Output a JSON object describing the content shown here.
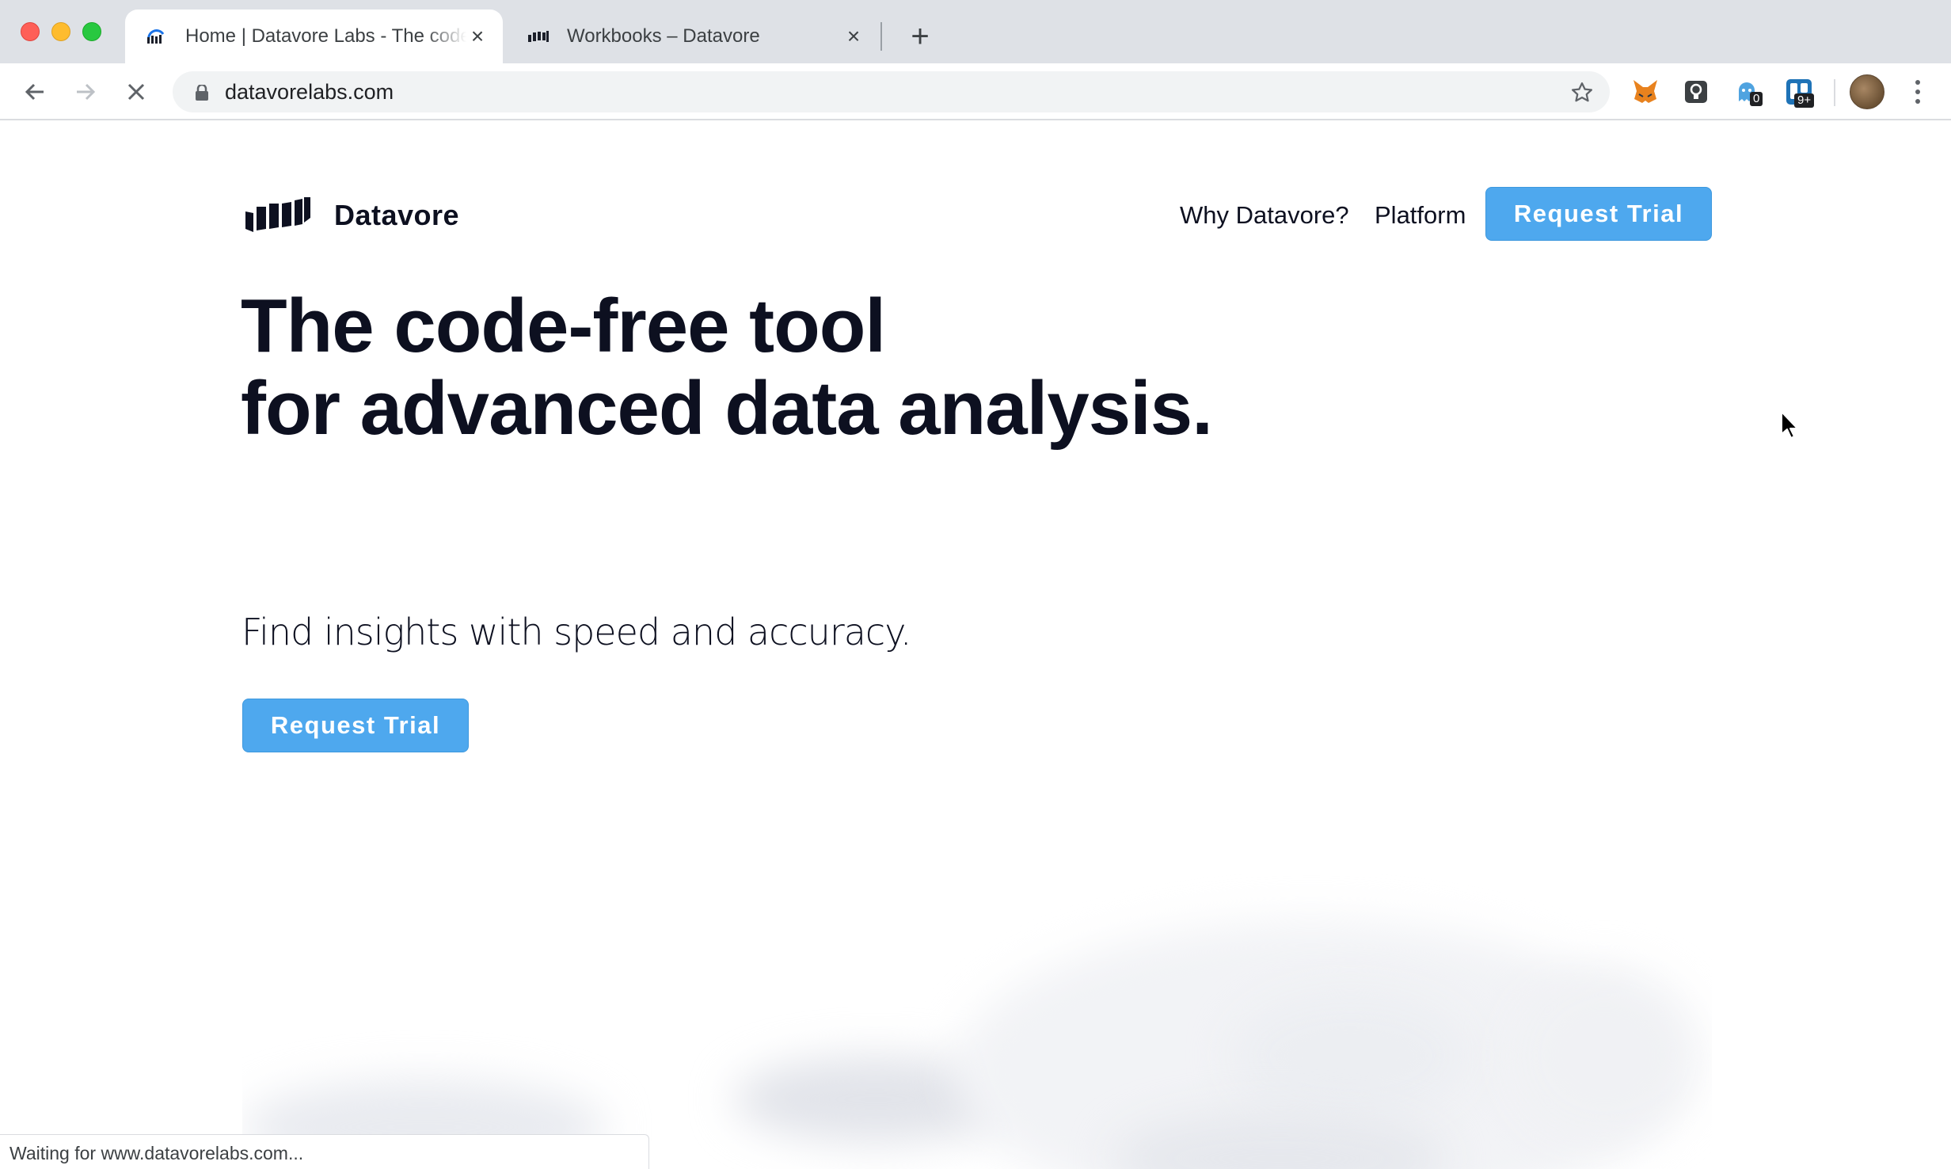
{
  "browser": {
    "tabs": [
      {
        "title": "Home | Datavore Labs - The code-free tool for advanced data analysis",
        "active": true
      },
      {
        "title": "Workbooks – Datavore",
        "active": false
      }
    ],
    "url": "datavorelabs.com",
    "extensions": [
      {
        "name": "fox-extension-icon"
      },
      {
        "name": "bulb-extension-icon"
      },
      {
        "name": "ghost-extension-icon",
        "badge": "0"
      },
      {
        "name": "trello-extension-icon",
        "badge": "9+"
      }
    ],
    "status_text": "Waiting for www.datavorelabs.com..."
  },
  "site": {
    "brand": "Datavore",
    "nav": {
      "why": "Why Datavore?",
      "platform": "Platform",
      "cta": "Request Trial"
    },
    "hero": {
      "headline_line1": "The code-free tool",
      "headline_line2": "for advanced data analysis.",
      "subhead": "Find insights with speed and accuracy.",
      "cta": "Request Trial"
    }
  },
  "colors": {
    "accent": "#4ea8ee",
    "text": "#0d1020"
  }
}
